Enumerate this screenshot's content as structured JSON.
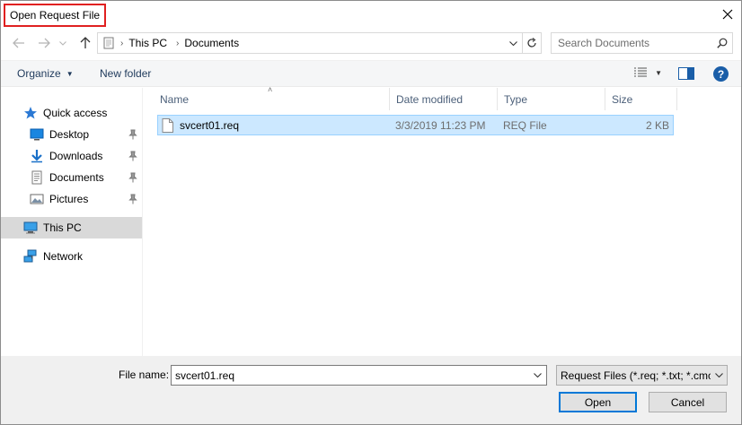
{
  "window": {
    "title": "Open Request File"
  },
  "nav": {
    "path": [
      "This PC",
      "Documents"
    ],
    "search_placeholder": "Search Documents"
  },
  "toolbar": {
    "organize_label": "Organize",
    "new_folder_label": "New folder"
  },
  "sidebar": {
    "items": [
      {
        "label": "Quick access",
        "icon": "star-icon"
      },
      {
        "label": "Desktop",
        "icon": "desktop-icon",
        "pinned": true
      },
      {
        "label": "Downloads",
        "icon": "download-icon",
        "pinned": true
      },
      {
        "label": "Documents",
        "icon": "documents-icon",
        "pinned": true
      },
      {
        "label": "Pictures",
        "icon": "pictures-icon",
        "pinned": true
      },
      {
        "label": "This PC",
        "icon": "computer-icon",
        "selected": true
      },
      {
        "label": "Network",
        "icon": "network-icon"
      }
    ]
  },
  "file_list": {
    "columns": [
      "Name",
      "Date modified",
      "Type",
      "Size"
    ],
    "rows": [
      {
        "name": "svcert01.req",
        "date_modified": "3/3/2019 11:23 PM",
        "type": "REQ File",
        "size": "2 KB"
      }
    ]
  },
  "footer": {
    "file_name_label": "File name:",
    "file_name_value": "svcert01.req",
    "file_type_filter": "Request Files (*.req; *.txt; *.cmc",
    "open_label": "Open",
    "cancel_label": "Cancel"
  },
  "colors": {
    "accent": "#0078d7",
    "selection": "#cce8ff",
    "title_highlight": "#e02020"
  }
}
